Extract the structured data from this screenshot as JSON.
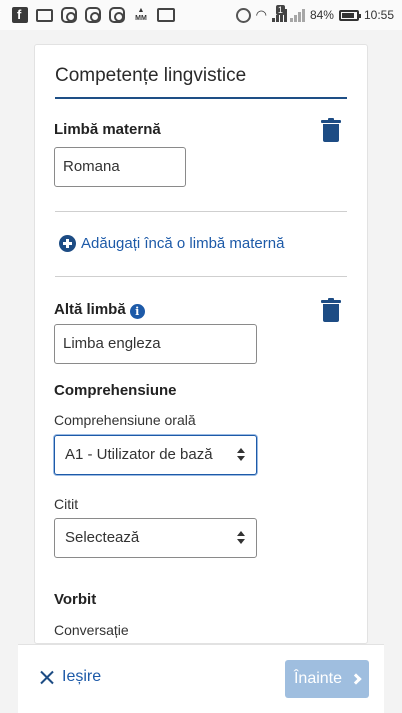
{
  "status_bar": {
    "battery": "84%",
    "time": "10:55",
    "notification_count": "1",
    "icons": [
      "facebook-icon",
      "image-icon",
      "instagram-icon",
      "instagram-icon",
      "instagram-icon",
      "mm-icon",
      "gmail-icon",
      "alarm-icon",
      "wifi-icon",
      "signal-icon",
      "signal-icon",
      "battery-icon"
    ]
  },
  "form": {
    "section_title": "Competențe lingvistice",
    "mother_tongue": {
      "label": "Limbă maternă",
      "value": "Romana"
    },
    "add_link": "Adăugați încă o limbă maternă",
    "other_language": {
      "label": "Altă limbă",
      "info_glyph": "i",
      "value": "Limba engleza"
    },
    "comprehension": {
      "heading": "Comprehensiune",
      "listening_label": "Comprehensiune orală",
      "listening_value": "A1 - Utilizator de bază",
      "reading_label": "Citit",
      "reading_value": "Selectează"
    },
    "speaking": {
      "heading": "Vorbit",
      "conversation_label": "Conversație"
    }
  },
  "footer": {
    "exit_label": "Ieșire",
    "next_label": "Înainte"
  },
  "colors": {
    "accent": "#1d5aa8",
    "icon": "#1d4c84",
    "next_disabled": "#9fbedf"
  }
}
